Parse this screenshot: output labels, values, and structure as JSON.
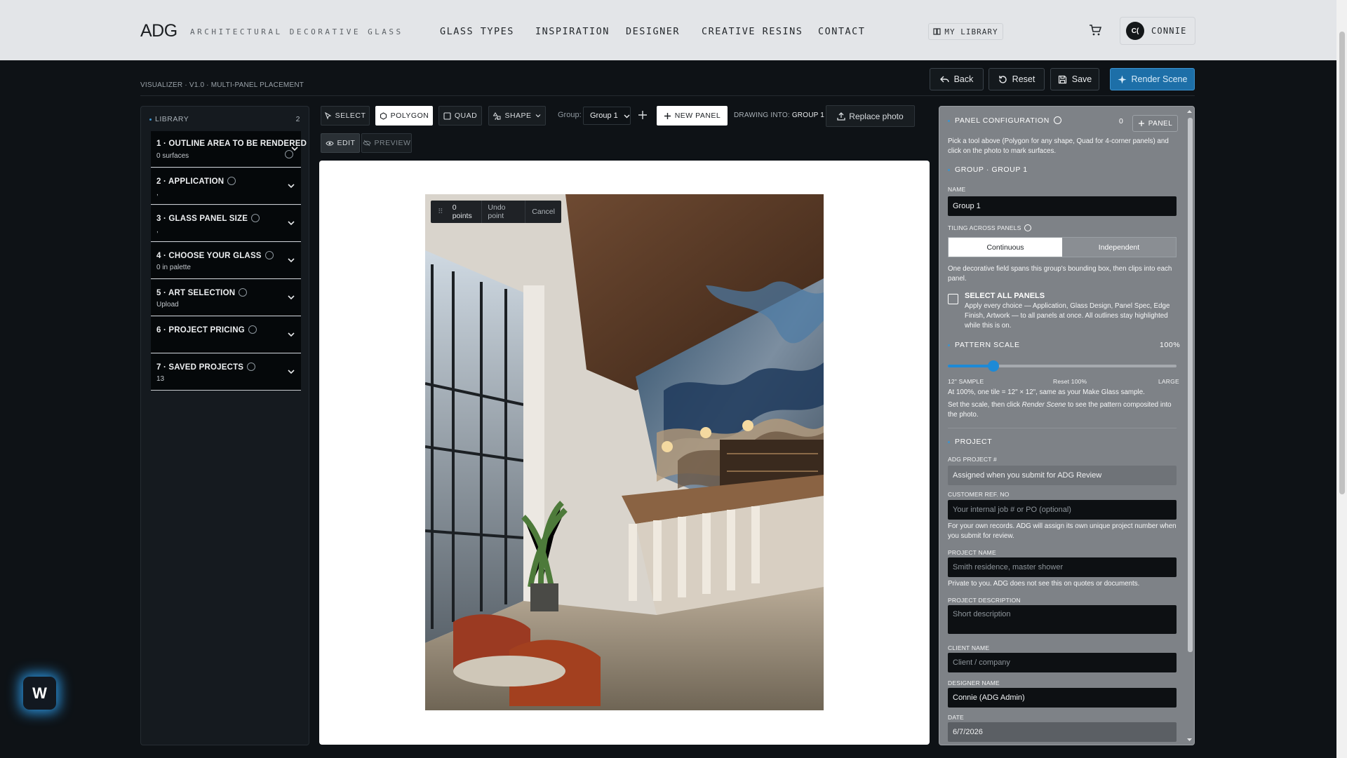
{
  "brand": {
    "logo": "ADG",
    "tagline": "ARCHITECTURAL DECORATIVE GLASS"
  },
  "nav": {
    "items": [
      "GLASS TYPES",
      "INSPIRATION",
      "DESIGNER",
      "CREATIVE RESINS",
      "CONTACT"
    ],
    "library": "MY LIBRARY"
  },
  "user": {
    "initials": "C(",
    "name": "CONNIE"
  },
  "breadcrumb": "VISUALIZER · V1.0 · MULTI-PANEL PLACEMENT",
  "actions": {
    "back": "Back",
    "reset": "Reset",
    "save": "Save",
    "render": "Render Scene"
  },
  "library": {
    "title": "LIBRARY",
    "count": "2",
    "steps": [
      {
        "title": "1 · OUTLINE AREA TO BE RENDERED",
        "sub": "0 surfaces"
      },
      {
        "title": "2 · APPLICATION",
        "sub": ","
      },
      {
        "title": "3 · GLASS PANEL SIZE",
        "sub": ","
      },
      {
        "title": "4 · CHOOSE YOUR GLASS",
        "sub": "0 in palette"
      },
      {
        "title": "5 · ART SELECTION",
        "sub": "Upload"
      },
      {
        "title": "6 · PROJECT PRICING",
        "sub": ""
      },
      {
        "title": "7 · SAVED PROJECTS",
        "sub": "13"
      }
    ]
  },
  "toolbar": {
    "select": "SELECT",
    "polygon": "POLYGON",
    "quad": "QUAD",
    "shape": "SHAPE",
    "group_label": "Group:",
    "group_value": "Group 1",
    "new_panel": "NEW PANEL",
    "drawing_into_label": "DRAWING INTO:",
    "drawing_into_value": "GROUP 1",
    "replace_photo": "Replace photo",
    "edit": "EDIT",
    "preview": "PREVIEW"
  },
  "polygon_bar": {
    "points": "0 points",
    "undo": "Undo point",
    "cancel": "Cancel"
  },
  "config": {
    "title": "PANEL CONFIGURATION",
    "count": "0",
    "panel_btn": "PANEL",
    "intro": "Pick a tool above (Polygon for any shape, Quad for 4-corner panels) and click on the photo to mark surfaces.",
    "group_heading": "GROUP · GROUP 1",
    "name_label": "NAME",
    "name_value": "Group 1",
    "tiling_label": "TILING ACROSS PANELS",
    "tiling_options": [
      "Continuous",
      "Independent"
    ],
    "tiling_desc": "One decorative field spans this group's bounding box, then clips into each panel.",
    "select_all_title": "SELECT ALL PANELS",
    "select_all_desc": "Apply every choice — Application, Glass Design, Panel Spec, Edge Finish, Artwork — to all panels at once. All outlines stay highlighted while this is on.",
    "pattern_label": "PATTERN SCALE",
    "pattern_value": "100%",
    "pattern_fraction": 0.2,
    "scale_min": "12\" SAMPLE",
    "scale_reset": "Reset 100%",
    "scale_max": "LARGE",
    "scale_note1": "At 100%, one tile = 12\" × 12\", same as your Make Glass sample.",
    "scale_note2_a": "Set the scale, then click ",
    "scale_note2_em": "Render Scene",
    "scale_note2_b": " to see the pattern composited into the photo.",
    "project_heading": "PROJECT",
    "adg_label": "ADG PROJECT #",
    "adg_value": "Assigned when you submit for ADG Review",
    "custref_label": "CUSTOMER REF. NO",
    "custref_placeholder": "Your internal job # or PO (optional)",
    "custref_note": "For your own records. ADG will assign its own unique project number when you submit for review.",
    "projname_label": "PROJECT NAME",
    "projname_placeholder": "Smith residence, master shower",
    "projname_note": "Private to you. ADG does not see this on quotes or documents.",
    "projdesc_label": "PROJECT DESCRIPTION",
    "projdesc_placeholder": "Short description",
    "client_label": "CLIENT NAME",
    "client_placeholder": "Client / company",
    "designer_label": "DESIGNER NAME",
    "designer_value": "Connie (ADG Admin)",
    "date_label": "DATE",
    "date_value": "6/7/2026"
  },
  "widget": {
    "letter": "W"
  },
  "colors": {
    "accent": "#1d6fa8",
    "slider": "#1e8ad6",
    "nav_bg": "#e3e5e8",
    "page_bg": "#0e1216"
  }
}
